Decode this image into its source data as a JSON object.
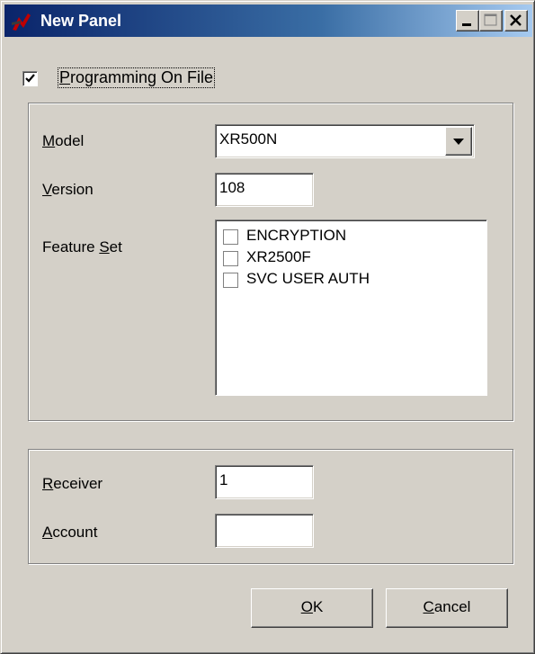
{
  "window": {
    "title": "New Panel",
    "controls": [
      "minimize-icon",
      "maximize-icon",
      "close-icon"
    ]
  },
  "programming_on_file": {
    "checked": true,
    "label_first": "P",
    "label_rest": "rogramming On File"
  },
  "panel": {
    "model": {
      "label_first": "M",
      "label_rest": "odel",
      "value": "XR500N"
    },
    "version": {
      "label_first": "V",
      "label_rest": "ersion",
      "value": "108"
    },
    "feature_set": {
      "label_pre": "Feature ",
      "label_first": "S",
      "label_rest": "et",
      "items": [
        {
          "label": "ENCRYPTION",
          "checked": false
        },
        {
          "label": "XR2500F",
          "checked": false
        },
        {
          "label": "SVC USER AUTH",
          "checked": false
        }
      ]
    }
  },
  "account_info": {
    "receiver": {
      "label_first": "R",
      "label_rest": "eceiver",
      "value": "1"
    },
    "account": {
      "label_first": "A",
      "label_rest": "ccount",
      "value": ""
    }
  },
  "buttons": {
    "ok": {
      "label_first": "O",
      "label_rest": "K"
    },
    "cancel": {
      "label_first": "C",
      "label_rest": "ancel"
    }
  },
  "colors": {
    "title_gradient_start": "#0a246a",
    "title_gradient_end": "#a6caf0",
    "face": "#d4d0c8"
  }
}
